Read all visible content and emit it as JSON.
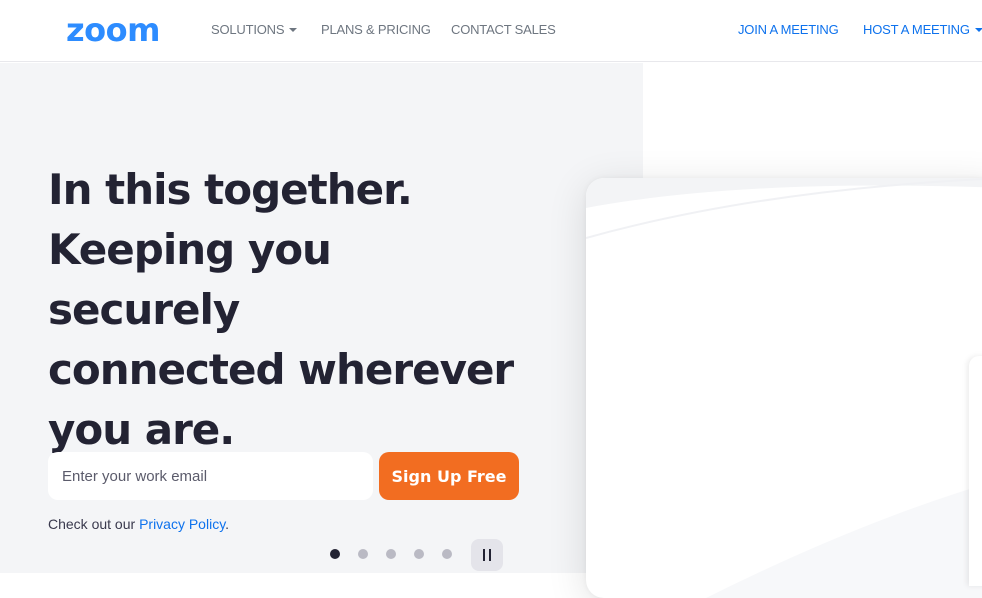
{
  "header": {
    "logo": "zoom",
    "nav_left": [
      "SOLUTIONS",
      "PLANS & PRICING",
      "CONTACT SALES"
    ],
    "nav_right": [
      "JOIN A MEETING",
      "HOST A MEETING"
    ]
  },
  "hero": {
    "headline": [
      "In this together.",
      "Keeping you",
      "securely",
      "connected wherever",
      "you are."
    ],
    "email_placeholder": "Enter your work email",
    "signup_label": "Sign Up Free",
    "privacy_prefix": "Check out our ",
    "privacy_link": "Privacy Policy",
    "privacy_suffix": ".",
    "carousel_count": 5,
    "carousel_active": 1
  },
  "colors": {
    "brand_blue": "#2d8cff",
    "link_blue": "#0e72ed",
    "cta_orange": "#f26d21",
    "headline": "#232333"
  },
  "icons": [
    "caret-down-icon",
    "pause-icon"
  ]
}
